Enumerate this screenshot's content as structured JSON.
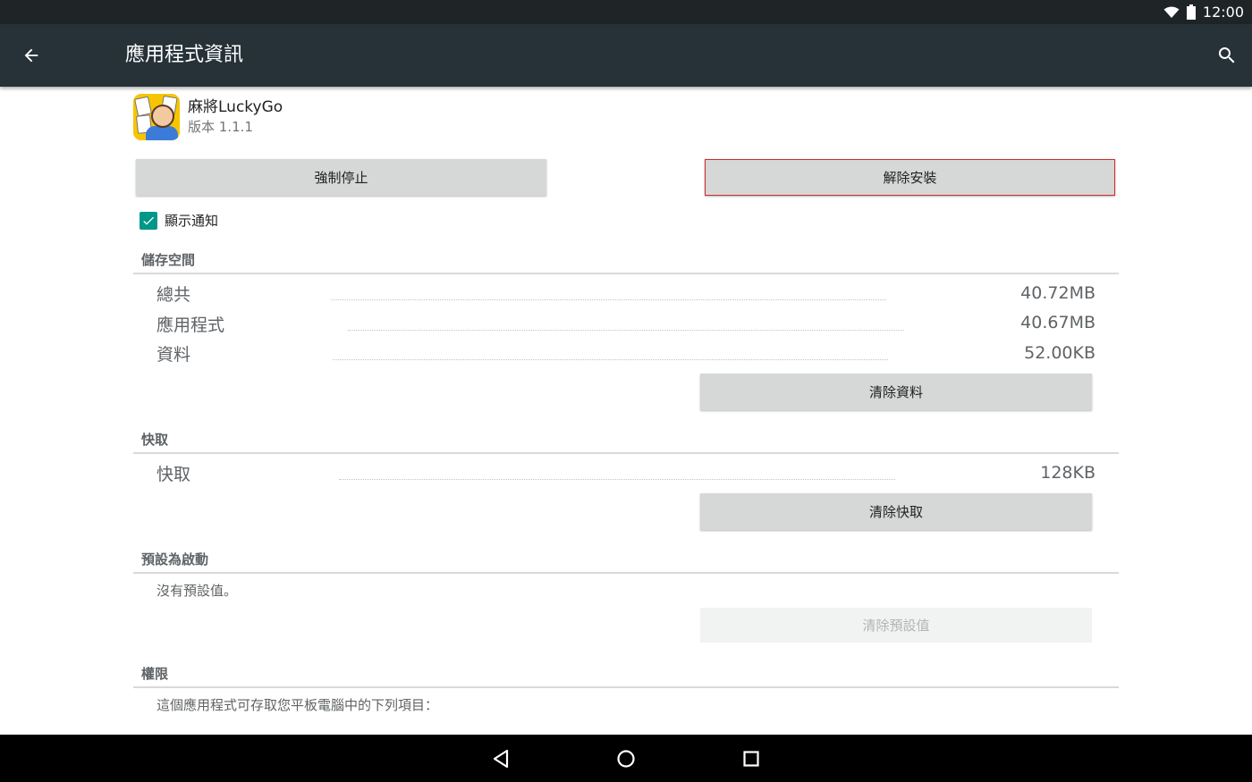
{
  "status_bar": {
    "time": "12:00",
    "icons": [
      "wifi-icon",
      "battery-icon"
    ]
  },
  "app_bar": {
    "title": "應用程式資訊",
    "back_icon": "arrow-back-icon",
    "search_icon": "search-icon"
  },
  "app": {
    "name": "麻將LuckyGo",
    "version": "版本 1.1.1",
    "icon": "mahjong-app-icon"
  },
  "actions": {
    "force_stop": "強制停止",
    "uninstall": "解除安裝"
  },
  "notifications": {
    "label": "顯示通知",
    "checked": true
  },
  "storage": {
    "title": "儲存空間",
    "rows": [
      {
        "label": "總共",
        "value": "40.72MB"
      },
      {
        "label": "應用程式",
        "value": "40.67MB"
      },
      {
        "label": "資料",
        "value": "52.00KB"
      }
    ],
    "clear_button": "清除資料"
  },
  "cache": {
    "title": "快取",
    "rows": [
      {
        "label": "快取",
        "value": "128KB"
      }
    ],
    "clear_button": "清除快取"
  },
  "launch_default": {
    "title": "預設為啟動",
    "text": "沒有預設值。",
    "clear_button": "清除預設值"
  },
  "permissions": {
    "title": "權限",
    "text": "這個應用程式可存取您平板電腦中的下列項目："
  },
  "nav_bar": {
    "back": "nav-back-icon",
    "home": "nav-home-icon",
    "recents": "nav-recents-icon"
  },
  "colors": {
    "app_bar": "#263238",
    "status_bar": "#1f2426",
    "accent": "#009688",
    "button": "#d6d7d7",
    "highlight_border": "#d22a2a"
  }
}
